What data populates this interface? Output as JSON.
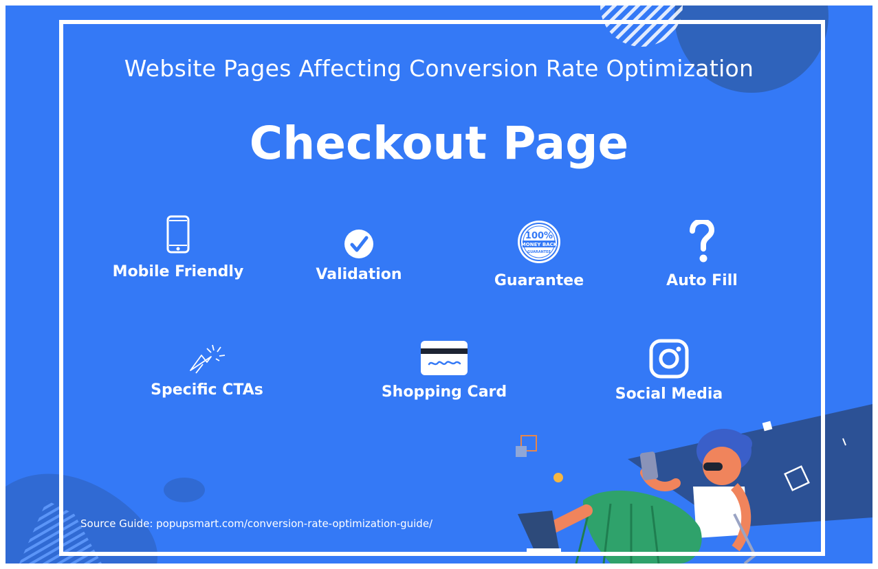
{
  "subtitle": "Website Pages Affecting  Conversion Rate Optimization",
  "title": "Checkout Page",
  "features": [
    {
      "label": "Mobile Friendly",
      "icon": "smartphone-icon"
    },
    {
      "label": "Validation",
      "icon": "check-circle-icon"
    },
    {
      "label": "Guarantee",
      "icon": "money-back-badge-icon"
    },
    {
      "label": "Auto Fill",
      "icon": "question-mark-icon"
    },
    {
      "label": "Specific CTAs",
      "icon": "cursor-click-icon"
    },
    {
      "label": "Shopping Card",
      "icon": "credit-card-icon"
    },
    {
      "label": "Social Media",
      "icon": "instagram-icon"
    }
  ],
  "badge": {
    "line1": "100%",
    "line2": "MONEY BACK",
    "line3": "GUARANTEE"
  },
  "source": "Source Guide: popupsmart.com/conversion-rate-optimization-guide/",
  "colors": {
    "background": "#3479f6",
    "text": "#ffffff",
    "accent_dark": "#2f5fb0"
  }
}
